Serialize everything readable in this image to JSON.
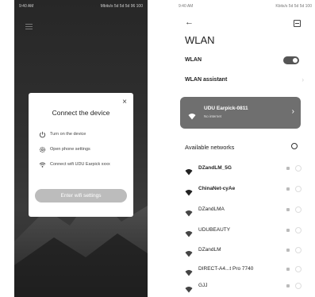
{
  "left_phone": {
    "status": {
      "time": "9:40 AM",
      "icons": "Mbits/s 5d 5d 5d 96 100"
    },
    "dialog": {
      "title": "Connect the device",
      "close": "×",
      "steps": [
        {
          "icon": "power-icon",
          "label": "Turn on the device"
        },
        {
          "icon": "settings-gear-icon",
          "label": "Open phone settings"
        },
        {
          "icon": "wifi-icon",
          "label": "Connect wifi UDU Earpick xxxx"
        }
      ],
      "button": "Enter wifi settings"
    }
  },
  "right_phone": {
    "status": {
      "time": "9:40 AM",
      "icons": "Kbits/s 5d 5d 5d 100"
    },
    "back": "←",
    "title": "WLAN",
    "wlan_label": "WLAN",
    "wlan_on": true,
    "assistant_label": "WLAN assistant",
    "assistant_chevron": "›",
    "connected": {
      "name": "UDU Earpick-0811",
      "status": "No internet",
      "chevron": "›"
    },
    "available_label": "Available networks",
    "networks": [
      {
        "name": "DZandLM_5G"
      },
      {
        "name": "ChinaNet-cyAe"
      },
      {
        "name": "DZandLMA"
      },
      {
        "name": "UDUBEAUTY"
      },
      {
        "name": "DZandLM"
      },
      {
        "name": "DIRECT-A4...t Pro 7740"
      },
      {
        "name": "GJJ"
      }
    ],
    "colors": {
      "connected_bg": "#6f6f6f",
      "toggle_on": "#555555"
    }
  }
}
